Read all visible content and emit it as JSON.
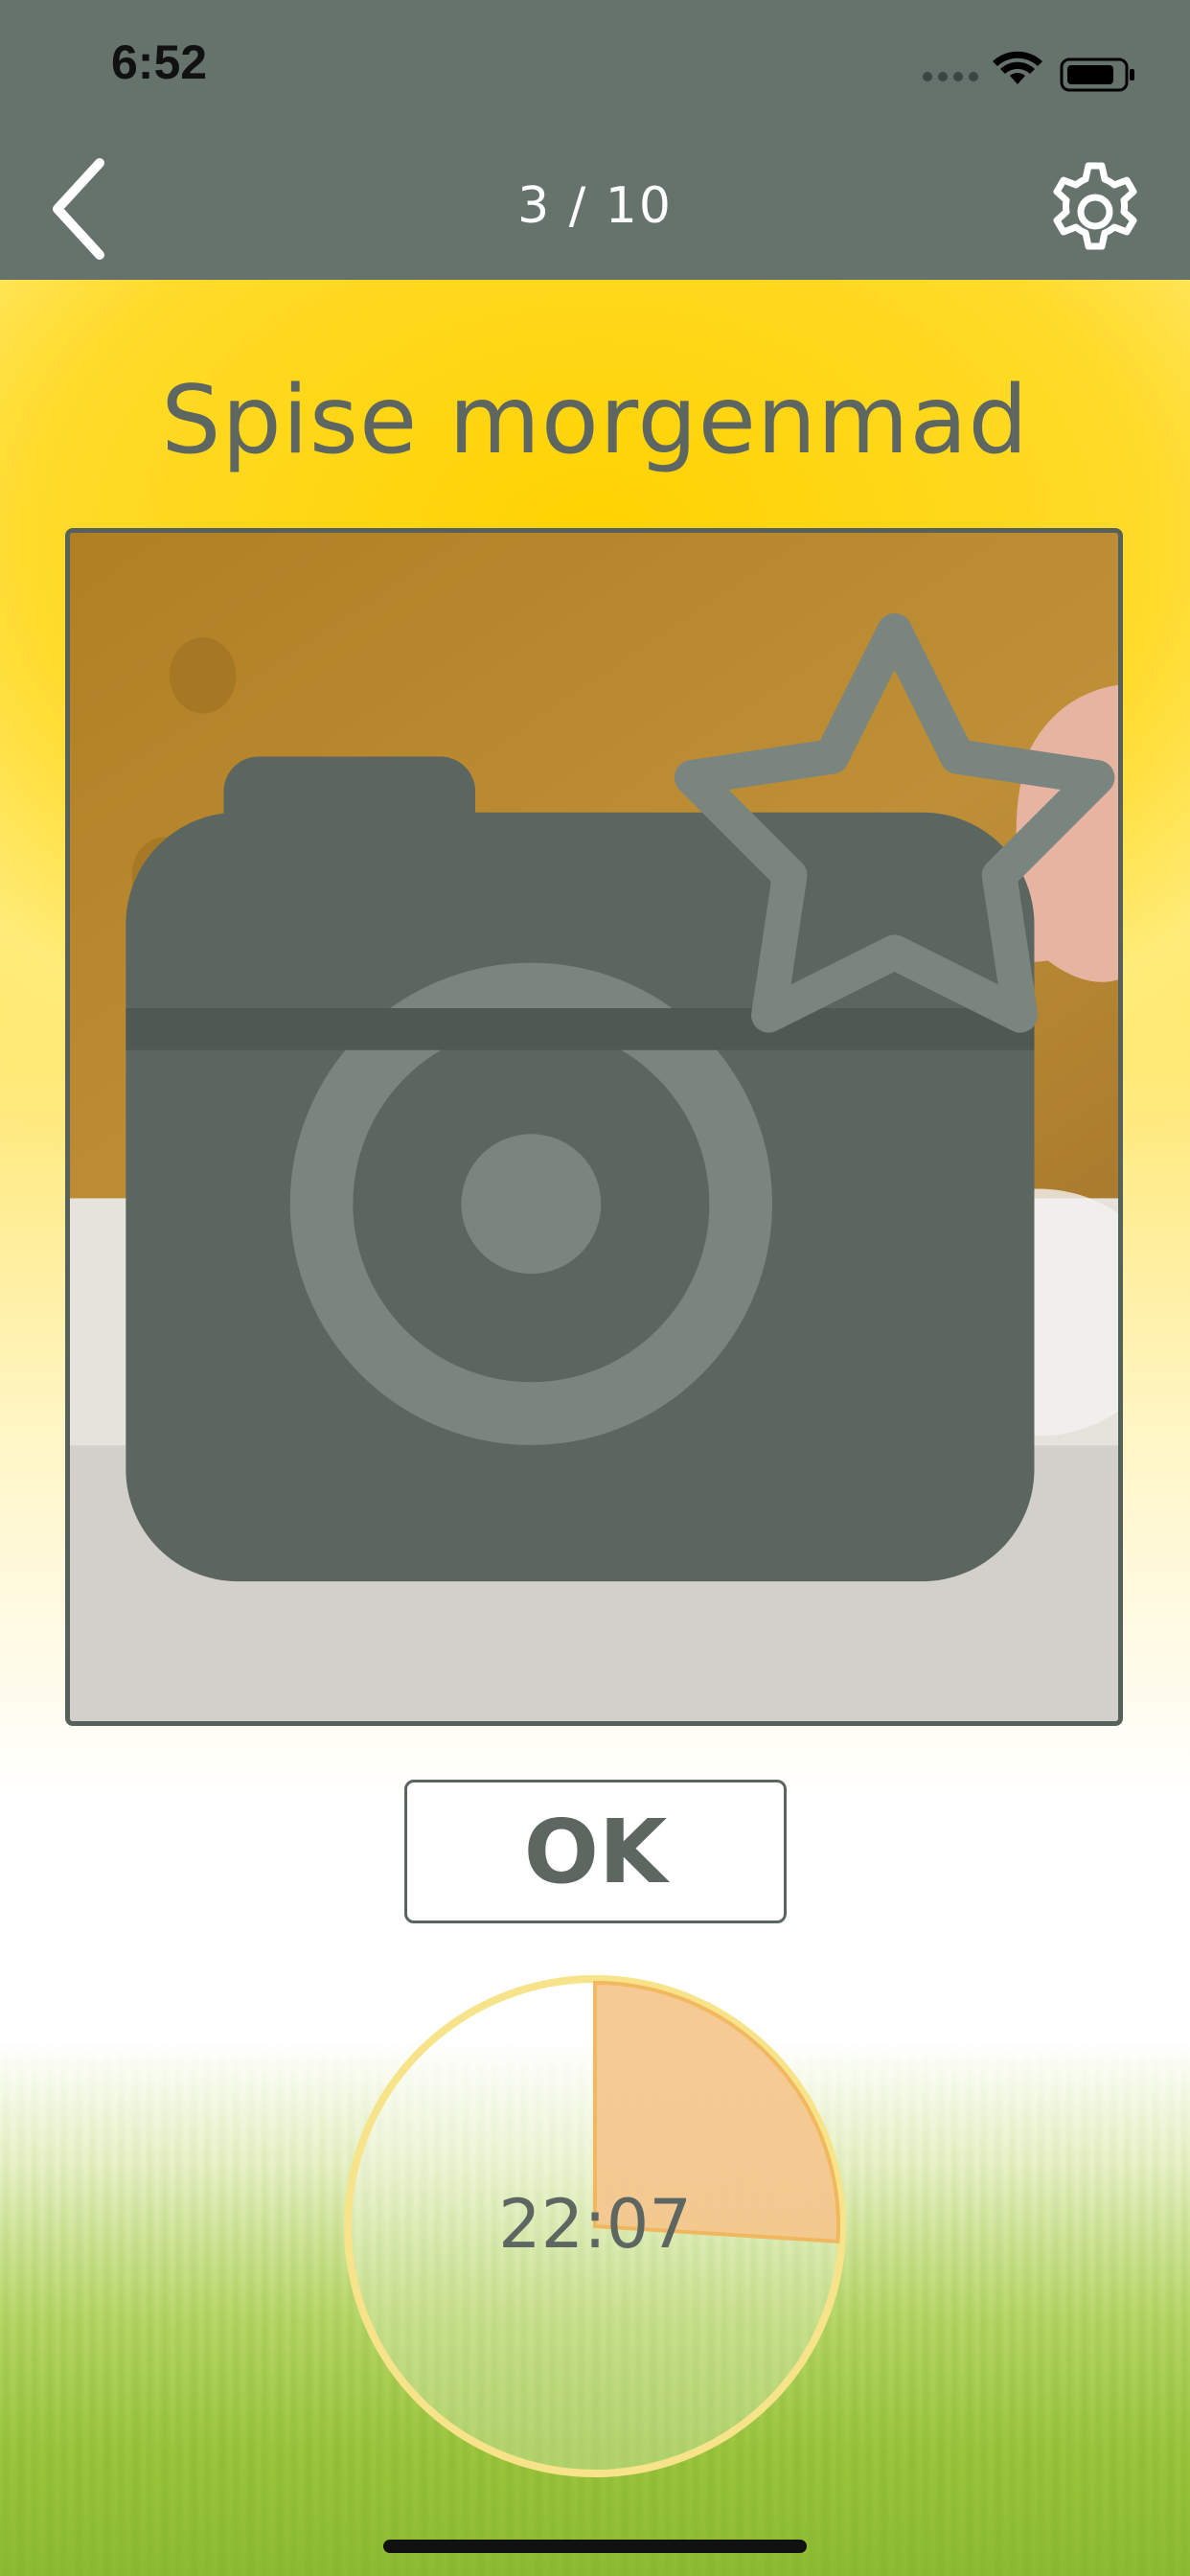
{
  "status_bar": {
    "time": "6:52"
  },
  "nav": {
    "back_icon": "chevron-left-icon",
    "step_counter": "3 / 10",
    "settings_icon": "gear-icon"
  },
  "activity": {
    "title": "Spise morgenmad",
    "photo_alt": "Skål med morgenmad",
    "camera_icon": "camera-star-icon"
  },
  "ok_button": {
    "label": "OK"
  },
  "timer": {
    "time_text": "22:07",
    "elapsed_fraction": 0.26,
    "fill_color": "#f5c88f",
    "ring_color": "#f7e48a"
  },
  "colors": {
    "topbar": "#66736d",
    "text": "#5d6661",
    "background_top": "#ffd400",
    "grass": "#8fbc34"
  }
}
